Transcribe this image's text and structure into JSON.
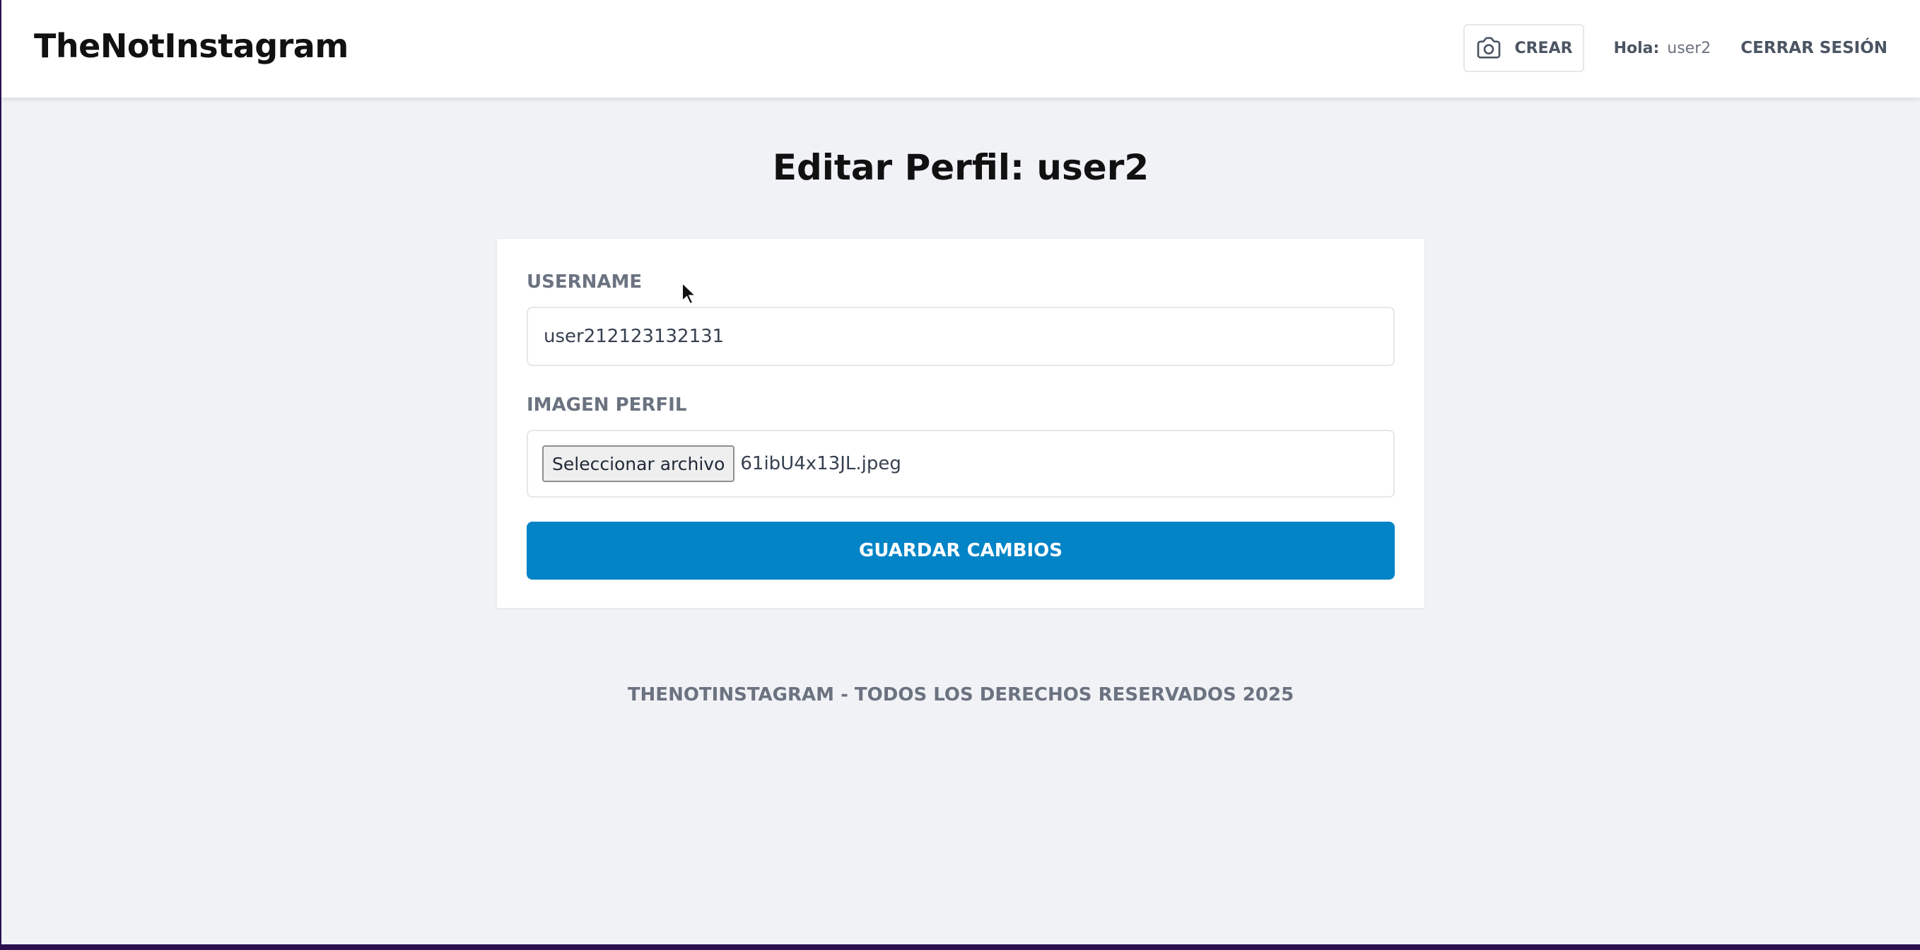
{
  "header": {
    "logo": "TheNotInstagram",
    "create_label": "CREAR",
    "create_icon": "camera-icon",
    "greeting_prefix": "Hola:",
    "greeting_user": "user2",
    "logout_label": "CERRAR SESIÓN"
  },
  "main": {
    "title": "Editar Perfil: user2",
    "form": {
      "username_label": "USERNAME",
      "username_value": "user212123132131",
      "image_label": "IMAGEN PERFIL",
      "file_button_label": "Seleccionar archivo",
      "file_name": "61ibU4x13JL.jpeg",
      "submit_label": "GUARDAR CAMBIOS"
    }
  },
  "footer": {
    "text": "THENOTINSTAGRAM - TODOS LOS DERECHOS RESERVADOS 2025"
  },
  "colors": {
    "primary": "#0284c7",
    "background": "#f0f2f6",
    "muted_text": "#6b7280"
  }
}
